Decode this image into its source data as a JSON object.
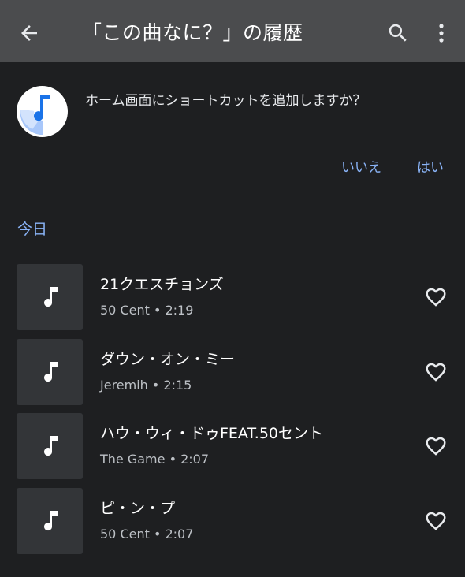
{
  "header": {
    "title": "「この曲なに？」の履歴",
    "back_icon": "arrow-back-icon",
    "search_icon": "search-icon",
    "more_icon": "more-vert-icon"
  },
  "shortcut_prompt": {
    "text": "ホーム画面にショートカットを追加しますか？",
    "no_label": "いいえ",
    "yes_label": "はい"
  },
  "section_title": "今日",
  "songs": [
    {
      "title": "21クエスチョンズ",
      "meta": "50 Cent • 2:19"
    },
    {
      "title": "ダウン・オン・ミー",
      "meta": "Jeremih • 2:15"
    },
    {
      "title": "ハウ・ウィ・ドゥFEAT.50セント",
      "meta": "The Game • 2:07"
    },
    {
      "title": "ピ・ン・プ",
      "meta": "50 Cent • 2:07"
    }
  ],
  "colors": {
    "background": "#1e1f21",
    "appbar": "#4b4c4e",
    "accent": "#8ab4f8",
    "thumb": "#333538"
  }
}
